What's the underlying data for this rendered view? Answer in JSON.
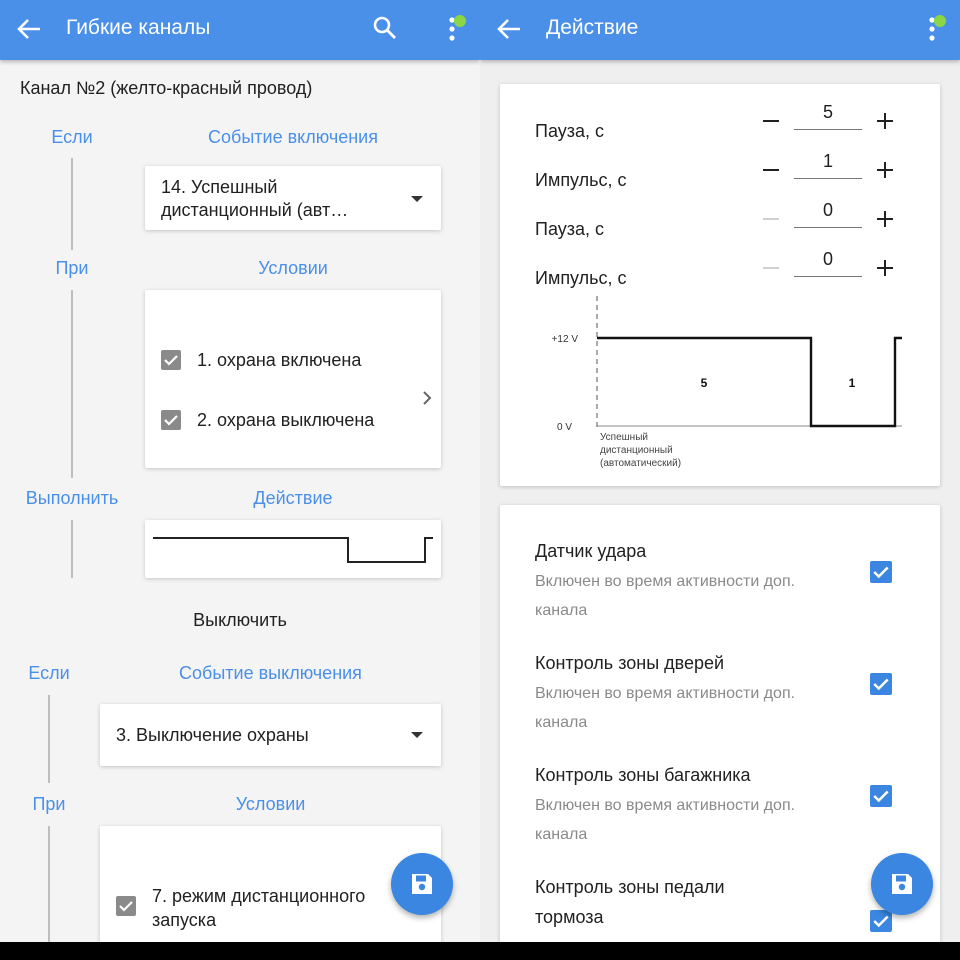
{
  "left": {
    "title": "Гибкие каналы",
    "channel": "Канал №2 (желто-красный провод)",
    "on": {
      "if_label": "Если",
      "event_label": "Событие включения",
      "event_value_line1": "14. Успешный",
      "event_value_line2": "дистанционный (авт…",
      "when_label": "При",
      "conditions_label": "Условии",
      "conditions": [
        "1. охрана включена",
        "2. охрана выключена"
      ],
      "do_label": "Выполнить",
      "action_label": "Действие"
    },
    "off_title": "Выключить",
    "off": {
      "if_label": "Если",
      "event_label": "Событие выключения",
      "event_value": "3. Выключение охраны",
      "when_label": "При",
      "conditions_label": "Условии",
      "condition_line1": "7. режим дистанционного",
      "condition_line2": "запуска"
    }
  },
  "right": {
    "title": "Действие",
    "params": [
      {
        "label": "Пауза, с",
        "value": "5",
        "minus_enabled": true
      },
      {
        "label": "Импульс, с",
        "value": "1",
        "minus_enabled": true
      },
      {
        "label": "Пауза, с",
        "value": "0",
        "minus_enabled": false
      },
      {
        "label": "Импульс, с",
        "value": "0",
        "minus_enabled": false
      }
    ],
    "diagram": {
      "high_label": "+12 V",
      "low_label": "0 V",
      "pause_value": "5",
      "impulse_value": "1",
      "event_line1": "Успешный",
      "event_line2": "дистанционный",
      "event_line3": "(автоматический)"
    },
    "features": [
      {
        "title": "Датчик удара",
        "sub1": "Включен во время активности доп.",
        "sub2": "канала",
        "checked": true
      },
      {
        "title": "Контроль зоны дверей",
        "sub1": "Включен во время активности доп.",
        "sub2": "канала",
        "checked": true
      },
      {
        "title": "Контроль зоны багажника",
        "sub1": "Включен во время активности доп.",
        "sub2": "канала",
        "checked": true
      },
      {
        "title": "Контроль зоны педали",
        "title2": "тормоза",
        "checked": true
      }
    ]
  },
  "colors": {
    "appbar": "#4a8fe8",
    "accent": "#3a86e0",
    "badge": "#8bd645"
  }
}
